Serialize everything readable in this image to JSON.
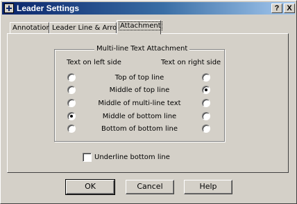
{
  "window": {
    "title": "Leader Settings",
    "help_glyph": "?",
    "close_glyph": "X"
  },
  "tabs": [
    {
      "label": "Annotation",
      "selected": false
    },
    {
      "label": "Leader Line & Arrow",
      "selected": false
    },
    {
      "label": "Attachment",
      "selected": true
    }
  ],
  "attachment": {
    "group_title": "Multi-line Text Attachment",
    "left_header": "Text on left side",
    "right_header": "Text on right side",
    "options": [
      {
        "label": "Top of top line",
        "left_checked": false,
        "right_checked": false
      },
      {
        "label": "Middle of top line",
        "left_checked": false,
        "right_checked": true
      },
      {
        "label": "Middle of multi-line text",
        "left_checked": false,
        "right_checked": false
      },
      {
        "label": "Middle of bottom line",
        "left_checked": true,
        "right_checked": false
      },
      {
        "label": "Bottom of bottom line",
        "left_checked": false,
        "right_checked": false
      }
    ],
    "underline_label": "Underline bottom line",
    "underline_checked": false
  },
  "buttons": {
    "ok": "OK",
    "cancel": "Cancel",
    "help": "Help"
  }
}
